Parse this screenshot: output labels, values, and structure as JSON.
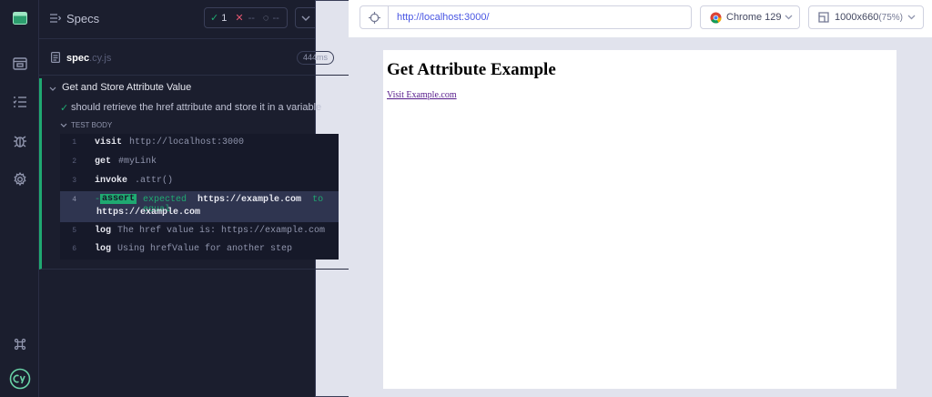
{
  "header": {
    "title": "Specs",
    "stats": {
      "passed": "1",
      "failed": "--",
      "pending": "--"
    }
  },
  "spec": {
    "name": "spec",
    "ext": ".cy.js",
    "duration": "444ms"
  },
  "suite": {
    "title": "Get and Store Attribute Value",
    "test_title": "should retrieve the href attribute and store it in a variable",
    "body_label": "TEST BODY",
    "commands": [
      {
        "num": "1",
        "name": "visit",
        "message": "http://localhost:3000"
      },
      {
        "num": "2",
        "name": "get",
        "message": "#myLink"
      },
      {
        "num": "3",
        "name": "invoke",
        "message": ".attr()"
      },
      {
        "num": "4",
        "name": "-",
        "badge": "assert",
        "message_pre": "expected",
        "value1": "https://example.com",
        "message_mid": "to equal",
        "value2": "https://example.com"
      },
      {
        "num": "5",
        "name": "log",
        "message": "The href value is: https://example.com"
      },
      {
        "num": "6",
        "name": "log",
        "message": "Using hrefValue for another step"
      }
    ]
  },
  "toolbar": {
    "url": "http://localhost:3000/",
    "browser": "Chrome 129",
    "viewport": "1000x660",
    "viewport_scale": "(75%)"
  },
  "aut": {
    "heading": "Get Attribute Example",
    "link_text": "Visit Example.com"
  },
  "colors": {
    "pass": "#1fa971",
    "fail": "#e45770",
    "url": "#4956e3"
  }
}
